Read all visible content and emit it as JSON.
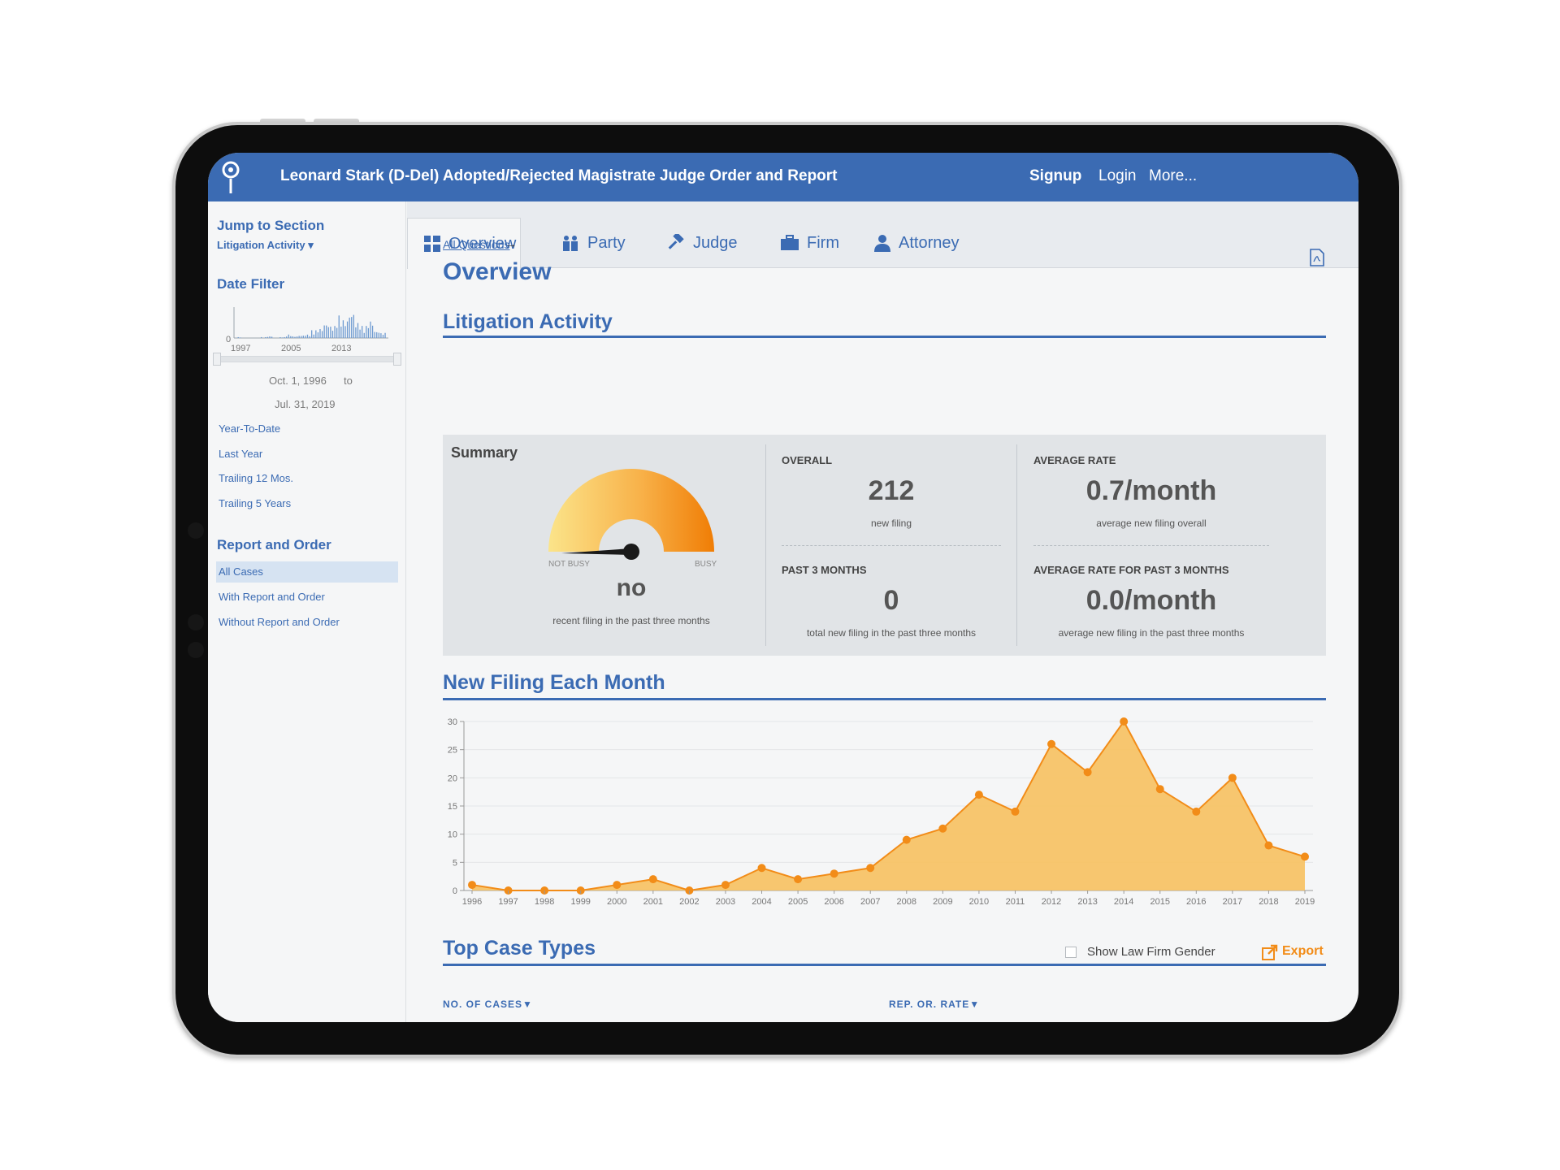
{
  "header": {
    "title": "Leonard Stark (D-Del) Adopted/Rejected Magistrate Judge Order and Report",
    "nav": [
      "Signup",
      "Login",
      "More..."
    ]
  },
  "sidebar": {
    "jump_heading": "Jump to Section",
    "jump_selected": "Litigation Activity ▾",
    "date_filter_heading": "Date Filter",
    "mini_chart": {
      "y_zero": "0",
      "ticks": [
        "1997",
        "2005",
        "2013"
      ]
    },
    "date_from": "Oct. 1, 1996",
    "date_to_word": "to",
    "date_to": "Jul. 31, 2019",
    "quick_ranges": [
      "Year-To-Date",
      "Last Year",
      "Trailing 12 Mos.",
      "Trailing 5 Years"
    ],
    "report_heading": "Report and Order",
    "report_items": [
      "All Cases",
      "With Report and Order",
      "Without Report and Order"
    ],
    "report_selected": "All Cases"
  },
  "tabs": [
    {
      "label": "Overview",
      "icon": "grid-icon",
      "active": true
    },
    {
      "label": "Party",
      "icon": "people-icon",
      "active": false
    },
    {
      "label": "Judge",
      "icon": "gavel-icon",
      "active": false
    },
    {
      "label": "Firm",
      "icon": "briefcase-icon",
      "active": false
    },
    {
      "label": "Attorney",
      "icon": "attorney-icon",
      "active": false
    }
  ],
  "main": {
    "breadcrumb": "All Questions",
    "page_title": "Overview",
    "litigation_heading": "Litigation Activity",
    "summary": {
      "title": "Summary",
      "gauge_left": "NOT BUSY",
      "gauge_right": "BUSY",
      "gauge_level": 0.0,
      "gauge_value": "no",
      "gauge_sub": "recent filing in the past three months",
      "overall_label": "OVERALL",
      "overall_value": "212",
      "overall_sub": "new filing",
      "past3_label": "PAST 3 MONTHS",
      "past3_value": "0",
      "past3_sub": "total new filing in the past three months",
      "avg_label": "AVERAGE RATE",
      "avg_value": "0.7/month",
      "avg_sub": "average new filing overall",
      "avg3_label": "AVERAGE RATE FOR PAST 3 MONTHS",
      "avg3_value": "0.0/month",
      "avg3_sub": "average new filing in the past three months"
    },
    "chart_heading": "New Filing Each Month",
    "top_heading": "Top Case Types",
    "gender_toggle": "Show Law Firm Gender",
    "export_label": "Export",
    "col_cases": "NO. OF CASES",
    "col_rate": "REP. OR. RATE"
  },
  "colors": {
    "brand": "#3b6bb3",
    "accent": "#f28c18",
    "area": "#f7c15f"
  },
  "chart_data": {
    "type": "area",
    "x": [
      "1996",
      "1997",
      "1998",
      "1999",
      "2000",
      "2001",
      "2002",
      "2003",
      "2004",
      "2005",
      "2006",
      "2007",
      "2008",
      "2009",
      "2010",
      "2011",
      "2012",
      "2013",
      "2014",
      "2015",
      "2016",
      "2017",
      "2018",
      "2019"
    ],
    "values": [
      1,
      0,
      0,
      0,
      1,
      2,
      0,
      1,
      4,
      2,
      3,
      4,
      9,
      11,
      17,
      14,
      26,
      21,
      30,
      18,
      14,
      20,
      8,
      6
    ],
    "ylim": [
      0,
      30
    ],
    "yticks": [
      "0",
      "5",
      "10",
      "15",
      "20",
      "25",
      "30"
    ],
    "grid": true
  }
}
